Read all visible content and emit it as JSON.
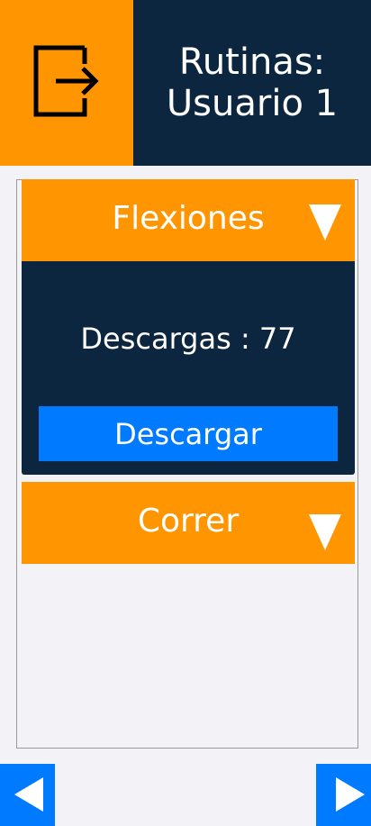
{
  "header": {
    "exit_icon": "logout-icon",
    "title": "Rutinas:\nUsuario 1"
  },
  "routines": [
    {
      "name": "Flexiones",
      "expanded": true,
      "toggle_icon": "triangle-down-icon",
      "downloads_text": "Descargas : 77",
      "download_label": "Descargar"
    },
    {
      "name": "Correr",
      "expanded": false,
      "toggle_icon": "triangle-down-icon"
    }
  ],
  "nav": {
    "prev_icon": "arrow-left-icon",
    "next_icon": "arrow-right-icon"
  },
  "colors": {
    "accent": "#ff9500",
    "dark": "#0d2640",
    "primary": "#007aff",
    "background": "#f2f2f7"
  }
}
